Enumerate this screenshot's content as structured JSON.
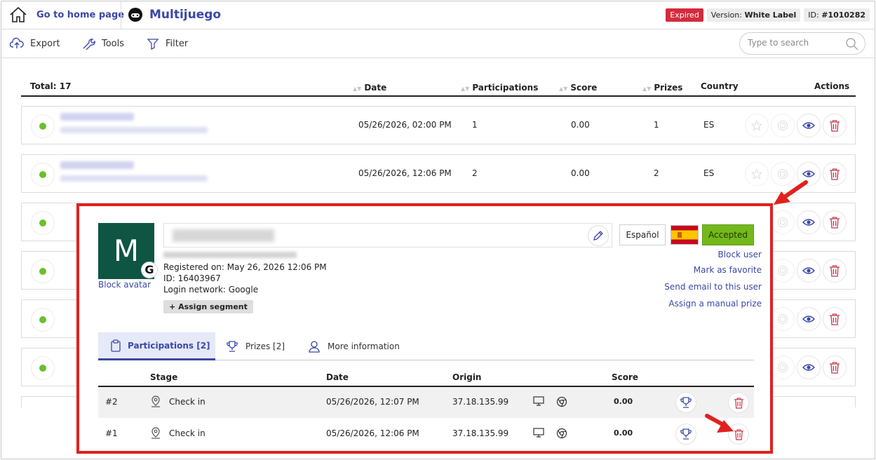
{
  "header": {
    "home_label": "Go to home page",
    "app_name": "Multijuego",
    "status_badge": "Expired",
    "version_label": "Version:",
    "version_value": "White Label",
    "id_label": "ID:",
    "id_value": "#1010282"
  },
  "toolbar": {
    "export_label": "Export",
    "tools_label": "Tools",
    "filter_label": "Filter",
    "search_placeholder": "Type to search"
  },
  "table": {
    "total_label": "Total: 17",
    "columns": {
      "date": "Date",
      "participations": "Participations",
      "score": "Score",
      "prizes": "Prizes",
      "country": "Country",
      "actions": "Actions"
    },
    "rows": [
      {
        "date": "05/26/2026, 02:00 PM",
        "participations": "1",
        "score": "0.00",
        "prizes": "1",
        "country": "ES"
      },
      {
        "date": "05/26/2026, 12:06 PM",
        "participations": "2",
        "score": "0.00",
        "prizes": "2",
        "country": "ES"
      }
    ]
  },
  "user_panel": {
    "avatar_letter": "M",
    "login_badge": "G",
    "block_avatar_label": "Block avatar",
    "registered_label": "Registered on: May 26, 2026 12:06 PM",
    "id_label": "ID: 16403967",
    "login_network_label": "Login network: Google",
    "assign_segment_label": "Assign segment",
    "language": "Español",
    "status": "Accepted",
    "links": {
      "block_user": "Block user",
      "mark_favorite": "Mark as favorite",
      "send_email": "Send email to this user",
      "assign_prize": "Assign a manual prize"
    },
    "tabs": {
      "participations": "Participations [2]",
      "prizes": "Prizes [2]",
      "more_info": "More information"
    },
    "participations_table": {
      "columns": {
        "stage": "Stage",
        "date": "Date",
        "origin": "Origin",
        "score": "Score"
      },
      "rows": [
        {
          "num": "#2",
          "stage": "Check in",
          "date": "05/26/2026, 12:07 PM",
          "origin": "37.18.135.99",
          "score": "0.00"
        },
        {
          "num": "#1",
          "stage": "Check in",
          "date": "05/26/2026, 12:06 PM",
          "origin": "37.18.135.99",
          "score": "0.00"
        }
      ]
    }
  },
  "colors": {
    "accent": "#3b47a8",
    "expired": "#d42b3c",
    "accepted": "#74b81b",
    "highlight": "#e1211d",
    "active_dot": "#6bbf2c",
    "delete": "#c8374b"
  }
}
